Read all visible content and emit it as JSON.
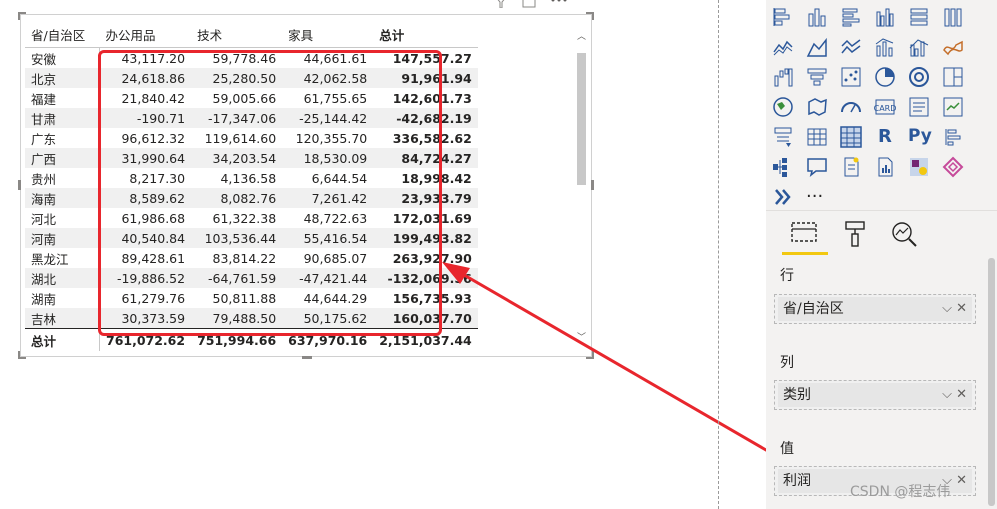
{
  "matrix": {
    "headers": {
      "row_field": "省/自治区",
      "col1": "办公用品",
      "col2": "技术",
      "col3": "家具",
      "total": "总计"
    },
    "rows": [
      {
        "province": "安徽",
        "office": "43,117.20",
        "tech": "59,778.46",
        "furniture": "44,661.61",
        "total": "147,557.27"
      },
      {
        "province": "北京",
        "office": "24,618.86",
        "tech": "25,280.50",
        "furniture": "42,062.58",
        "total": "91,961.94"
      },
      {
        "province": "福建",
        "office": "21,840.42",
        "tech": "59,005.66",
        "furniture": "61,755.65",
        "total": "142,601.73"
      },
      {
        "province": "甘肃",
        "office": "-190.71",
        "tech": "-17,347.06",
        "furniture": "-25,144.42",
        "total": "-42,682.19"
      },
      {
        "province": "广东",
        "office": "96,612.32",
        "tech": "119,614.60",
        "furniture": "120,355.70",
        "total": "336,582.62"
      },
      {
        "province": "广西",
        "office": "31,990.64",
        "tech": "34,203.54",
        "furniture": "18,530.09",
        "total": "84,724.27"
      },
      {
        "province": "贵州",
        "office": "8,217.30",
        "tech": "4,136.58",
        "furniture": "6,644.54",
        "total": "18,998.42"
      },
      {
        "province": "海南",
        "office": "8,589.62",
        "tech": "8,082.76",
        "furniture": "7,261.42",
        "total": "23,933.79"
      },
      {
        "province": "河北",
        "office": "61,986.68",
        "tech": "61,322.38",
        "furniture": "48,722.63",
        "total": "172,031.69"
      },
      {
        "province": "河南",
        "office": "40,540.84",
        "tech": "103,536.44",
        "furniture": "55,416.54",
        "total": "199,493.82"
      },
      {
        "province": "黑龙江",
        "office": "89,428.61",
        "tech": "83,814.22",
        "furniture": "90,685.07",
        "total": "263,927.90"
      },
      {
        "province": "湖北",
        "office": "-19,886.52",
        "tech": "-64,761.59",
        "furniture": "-47,421.44",
        "total": "-132,069.56"
      },
      {
        "province": "湖南",
        "office": "61,279.76",
        "tech": "50,811.88",
        "furniture": "44,644.29",
        "total": "156,735.93"
      },
      {
        "province": "吉林",
        "office": "30,373.59",
        "tech": "79,488.50",
        "furniture": "50,175.62",
        "total": "160,037.70"
      }
    ],
    "totals": {
      "label": "总计",
      "office": "761,072.62",
      "tech": "751,994.66",
      "furniture": "637,970.16",
      "total": "2,151,037.44"
    }
  },
  "panel": {
    "visual_icons": [
      "stacked-bar-icon",
      "stacked-column-icon",
      "clustered-bar-icon",
      "clustered-column-icon",
      "100pct-bar-icon",
      "100pct-column-icon",
      "line-chart-icon",
      "area-chart-icon",
      "stacked-area-icon",
      "line-column-icon",
      "line-clustered-column-icon",
      "ribbon-chart-icon",
      "waterfall-icon",
      "funnel-icon",
      "scatter-icon",
      "pie-icon",
      "donut-icon",
      "treemap-icon",
      "map-icon",
      "filled-map-icon",
      "gauge-icon",
      "card-icon",
      "multi-row-card-icon",
      "kpi-icon",
      "slicer-icon",
      "table-icon",
      "matrix-icon",
      "r-visual-icon",
      "python-visual-icon",
      "key-influencers-icon",
      "decomposition-tree-icon",
      "qa-icon",
      "smart-narrative-icon",
      "paginated-report-icon",
      "power-apps-icon",
      "power-automate-icon",
      "more-visuals-chevron-icon",
      "more-options-icon"
    ],
    "tabs": [
      "fields-tab-icon",
      "format-tab-icon",
      "analytics-tab-icon"
    ],
    "sections": [
      {
        "label": "行",
        "value": "省/自治区"
      },
      {
        "label": "列",
        "value": "类别"
      },
      {
        "label": "值",
        "value": "利润"
      }
    ],
    "r_label": "R",
    "py_label": "Py",
    "card_label": "123",
    "more_dots": "···"
  },
  "watermark": "CSDN @程志伟",
  "colors": {
    "highlight": "#e8262d",
    "accent": "#f2c811",
    "icon_blue": "#2b579a"
  }
}
